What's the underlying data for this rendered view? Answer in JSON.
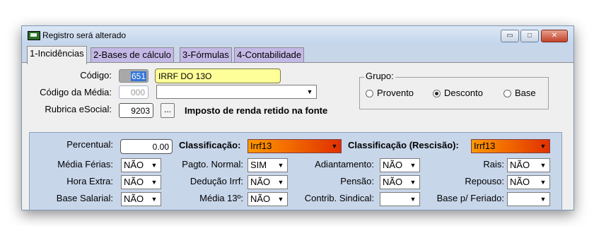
{
  "window": {
    "title": "Registro será alterado",
    "controls": {
      "minimize": "▭",
      "maximize": "□",
      "close": "✕"
    }
  },
  "tabs": [
    {
      "label": "1-Incidências",
      "active": true
    },
    {
      "label": "2-Bases de cálculo",
      "active": false
    },
    {
      "label": "3-Fórmulas",
      "active": false
    },
    {
      "label": "4-Contabilidade",
      "active": false
    }
  ],
  "form": {
    "codigo_label": "Código:",
    "codigo_value": "651",
    "nome_value": "IRRF DO 13O",
    "codigo_media_label": "Código da Média:",
    "codigo_media_value": "000",
    "codigo_media_desc": "",
    "rubrica_label": "Rubrica eSocial:",
    "rubrica_value": "9203",
    "rubrica_button": "...",
    "rubrica_desc": "Imposto de renda retido na fonte"
  },
  "grupo": {
    "legend": "Grupo:",
    "options": [
      {
        "label": "Provento",
        "selected": false
      },
      {
        "label": "Desconto",
        "selected": true
      },
      {
        "label": "Base",
        "selected": false
      }
    ]
  },
  "incidencias": {
    "percentual_label": "Percentual:",
    "percentual_value": "0.00",
    "classificacao_label": "Classificação:",
    "classificacao_value": "Irrf13",
    "classificacao_rescisao_label": "Classificação (Rescisão):",
    "classificacao_rescisao_value": "Irrf13",
    "fields": [
      {
        "label": "Média Férias:",
        "value": "NÃO"
      },
      {
        "label": "Pagto. Normal:",
        "value": "SIM"
      },
      {
        "label": "Adiantamento:",
        "value": "NÃO"
      },
      {
        "label": "Rais:",
        "value": "NÃO"
      },
      {
        "label": "Hora Extra:",
        "value": "NÃO"
      },
      {
        "label": "Dedução Irrf:",
        "value": "NÃO"
      },
      {
        "label": "Pensão:",
        "value": "NÃO"
      },
      {
        "label": "Repouso:",
        "value": "NÃO"
      },
      {
        "label": "Base Salarial:",
        "value": "NÃO"
      },
      {
        "label": "Média 13º:",
        "value": "NÃO"
      },
      {
        "label": "Contrib. Sindical:",
        "value": ""
      },
      {
        "label": "Base p/ Feriado:",
        "value": ""
      }
    ]
  },
  "colors": {
    "window_bg": "#c8d6ea",
    "tab_inactive": "#c4b8e6",
    "name_highlight": "#ffff99",
    "code_selected": "#3375d6",
    "classification_gradient_start": "#ff9900",
    "classification_gradient_end": "#e03000"
  }
}
